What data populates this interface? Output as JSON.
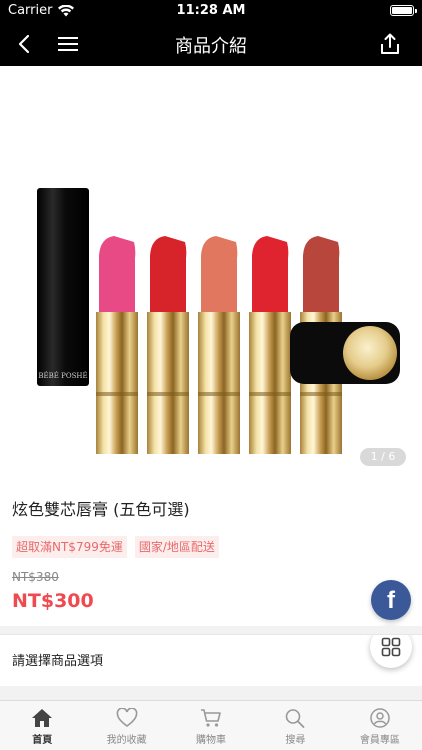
{
  "status_bar": {
    "carrier": "Carrier",
    "time": "11:28 AM"
  },
  "nav": {
    "title": "商品介紹",
    "back_icon": "back-icon",
    "menu_icon": "menu-icon",
    "share_icon": "share-icon"
  },
  "gallery": {
    "page_indicator": "1 / 6",
    "brand_text": "BÉBÉ POSHÉ",
    "lipstick_colors": [
      "#e84a86",
      "#d7232a",
      "#e0775e",
      "#df2430",
      "#b8463c"
    ]
  },
  "product": {
    "title": "炫色雙芯唇膏 (五色可選)",
    "tags": [
      "超取滿NT$799免運",
      "國家/地區配送"
    ],
    "original_price": "NT$380",
    "price": "NT$300"
  },
  "fab": {
    "facebook_label": "f"
  },
  "options": {
    "label": "請選擇商品選項"
  },
  "tab_bar": {
    "items": [
      {
        "label": "首頁",
        "icon": "home-icon",
        "active": true
      },
      {
        "label": "我的收藏",
        "icon": "heart-icon",
        "active": false
      },
      {
        "label": "購物車",
        "icon": "cart-icon",
        "active": false
      },
      {
        "label": "搜尋",
        "icon": "search-icon",
        "active": false
      },
      {
        "label": "會員專區",
        "icon": "user-icon",
        "active": false
      }
    ]
  },
  "colors": {
    "accent": "#ef4a50",
    "tag_bg": "#fdeeee",
    "facebook": "#3b5998"
  }
}
